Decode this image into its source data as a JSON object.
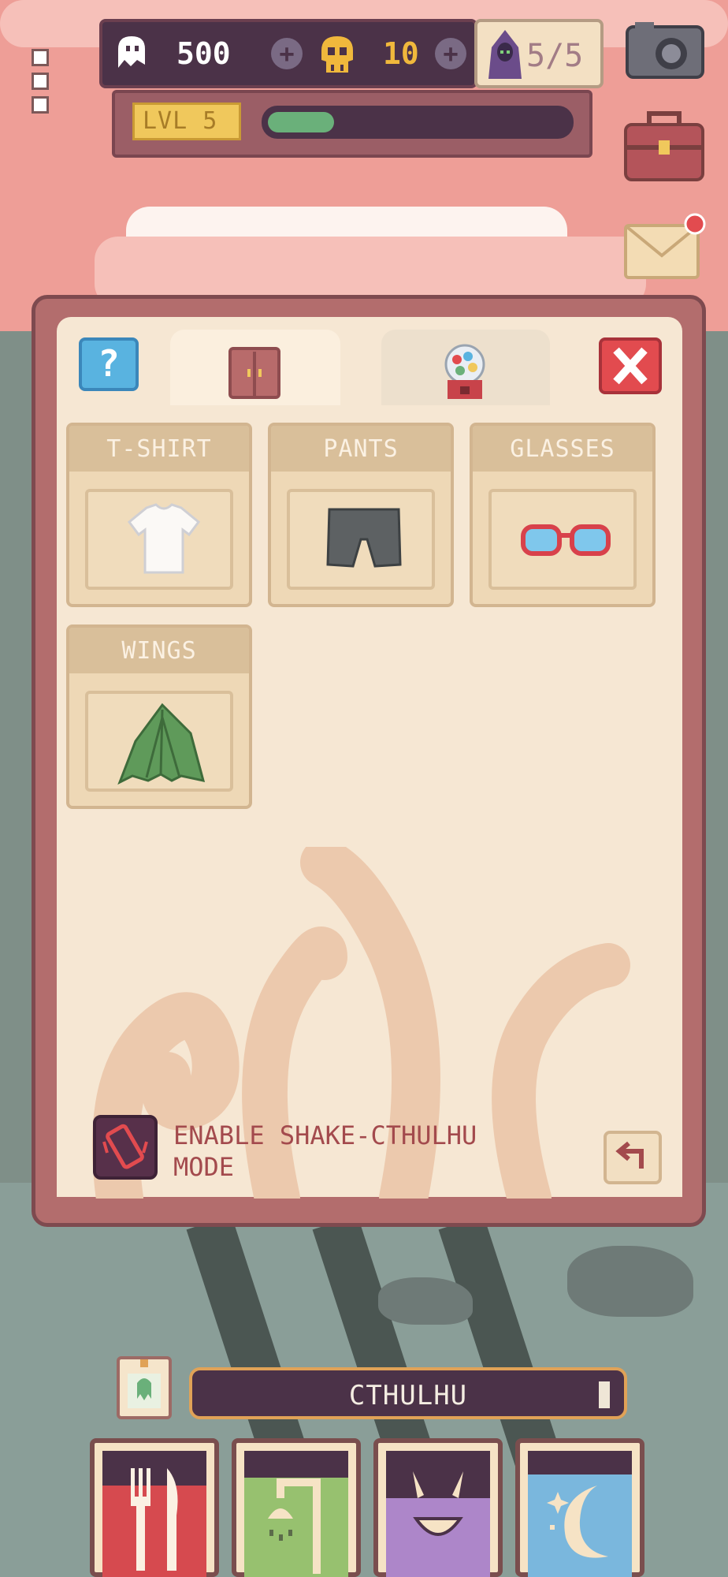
{
  "hud": {
    "ghost_currency": "500",
    "skull_currency": "10",
    "cultists": "5/5",
    "level_label": "LVL 5",
    "xp_progress": 0.22
  },
  "wardrobe": {
    "slots": [
      {
        "label": "T-SHIRT",
        "item": "tshirt-icon"
      },
      {
        "label": "PANTS",
        "item": "pants-icon"
      },
      {
        "label": "GLASSES",
        "item": "glasses-icon"
      },
      {
        "label": "WINGS",
        "item": "wings-icon"
      }
    ],
    "shake_mode_label": "ENABLE SHAKE-CTHULHU MODE"
  },
  "pet": {
    "name": "CTHULHU"
  },
  "colors": {
    "accent_red": "#e24b4f",
    "panel": "#f6e7d3",
    "frame": "#b36d6d",
    "dark_purple": "#4b3248"
  }
}
